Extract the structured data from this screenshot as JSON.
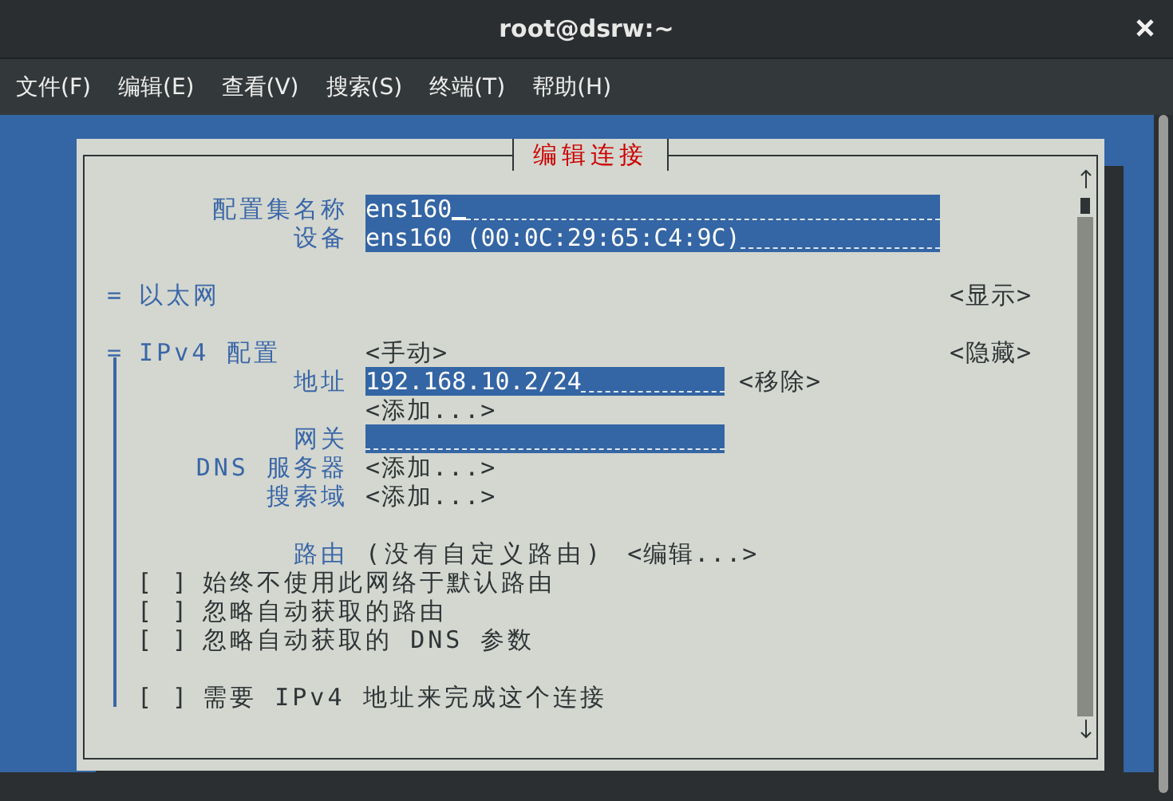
{
  "window": {
    "title": "root@dsrw:~"
  },
  "menu": [
    {
      "label": "文件(F)"
    },
    {
      "label": "编辑(E)"
    },
    {
      "label": "查看(V)"
    },
    {
      "label": "搜索(S)"
    },
    {
      "label": "终端(T)"
    },
    {
      "label": "帮助(H)"
    }
  ],
  "dialog": {
    "title": "编辑连接",
    "fields": [
      {
        "label": "配置集名称",
        "value": "ens160",
        "focused": true
      },
      {
        "label": "设备",
        "value": "ens160 (00:0C:29:65:C4:9C)",
        "focused": false
      }
    ],
    "sections": [
      {
        "marker": "=",
        "title": "以太网",
        "toggle": "<显示>",
        "expanded": false
      },
      {
        "marker": "=",
        "title": "IPv4 配置",
        "method": "<手动>",
        "toggle": "<隐藏>",
        "expanded": true,
        "rows": [
          {
            "kind": "field",
            "label": "地址",
            "value": "192.168.10.2/24",
            "action": "<移除>"
          },
          {
            "kind": "button",
            "action": "<添加...>"
          },
          {
            "kind": "field",
            "label": "网关"
          },
          {
            "kind": "button",
            "label": "DNS 服务器",
            "action": "<添加...>"
          },
          {
            "kind": "button",
            "label": "搜索域",
            "action": "<添加...>"
          },
          {
            "kind": "gap"
          },
          {
            "kind": "routes",
            "label": "路由",
            "value": "(没有自定义路由)",
            "action": "<编辑...>"
          },
          {
            "kind": "check",
            "box": "[ ]",
            "label": "始终不使用此网络于默认路由",
            "checked": false
          },
          {
            "kind": "check",
            "box": "[ ]",
            "label": "忽略自动获取的路由",
            "checked": false
          },
          {
            "kind": "check",
            "box": "[ ]",
            "label": "忽略自动获取的 DNS 参数",
            "checked": false
          },
          {
            "kind": "gap"
          },
          {
            "kind": "check",
            "box": "[ ]",
            "label": "需要 IPv4 地址来完成这个连接",
            "checked": false
          }
        ]
      }
    ]
  }
}
